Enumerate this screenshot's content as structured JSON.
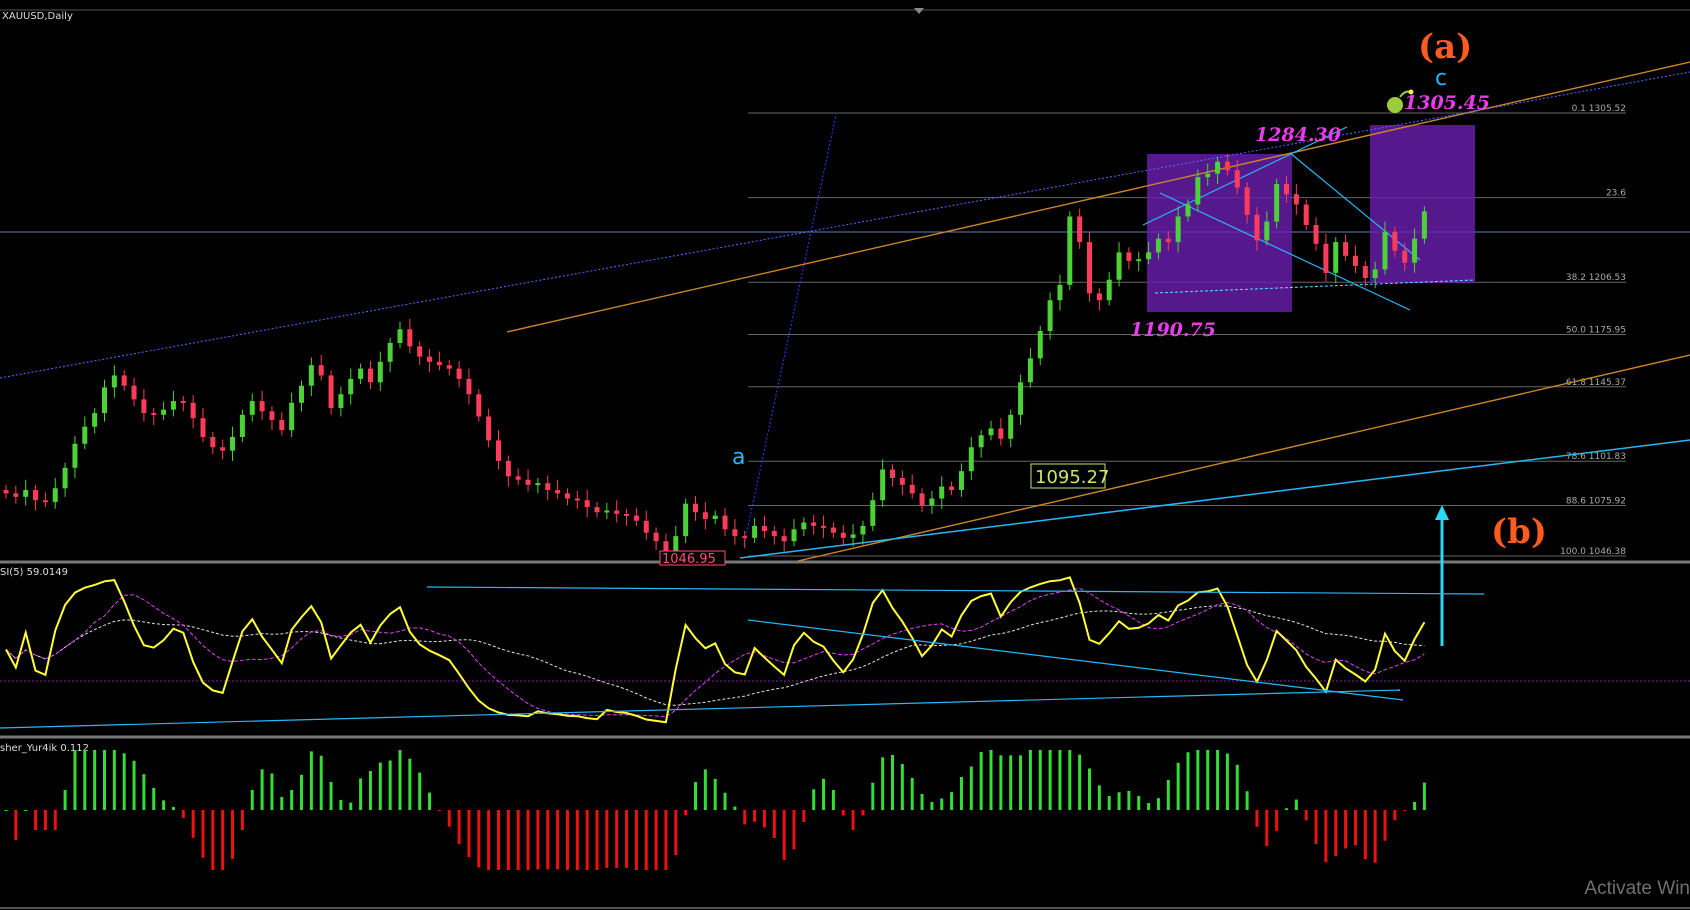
{
  "symbol_label": "XAUUSD,Daily",
  "rsi_label": "SI(5) 59.0149",
  "fisher_label": "sher_Yur4ik 0.112",
  "watermark": "Activate Win",
  "wave_labels": {
    "a_small": "a",
    "c_small": "c",
    "a_big": "(a)",
    "b_big": "(b)"
  },
  "price_labels": {
    "high1": "1284.30",
    "high2": "1305.45",
    "low1": "1190.75",
    "box1": "1095.27",
    "low0": "1046.95"
  },
  "fib_levels": [
    {
      "label": "0.1 1305.52",
      "price": 1305.52
    },
    {
      "label": "23.6",
      "price": 1256.0
    },
    {
      "label": "38.2 1206.53",
      "price": 1206.53
    },
    {
      "label": "50.0 1175.95",
      "price": 1175.95
    },
    {
      "label": "61.8 1145.37",
      "price": 1145.37
    },
    {
      "label": "78.6 1101.83",
      "price": 1101.83
    },
    {
      "label": "88.6 1075.92",
      "price": 1075.92
    },
    {
      "label": "100.0 1046.38",
      "price": 1046.38
    }
  ],
  "colors": {
    "bull": "#4cd137",
    "bear": "#ff3b5c",
    "rsi": "#ffff33",
    "rsi_ma": "#e040fb",
    "rsi_ma2": "#e0e0e0",
    "trend_blue": "#29b6f6",
    "trend_orange": "#c8862a",
    "box": "#6a1fb0",
    "fisher_up": "#33dd33",
    "fisher_down": "#ee1111"
  },
  "chart_data": {
    "type": "candlestick",
    "title": "XAUUSD,Daily",
    "ylim": [
      1040,
      1325
    ],
    "closes": [
      1083,
      1081,
      1085,
      1079,
      1078,
      1086,
      1098,
      1112,
      1122,
      1130,
      1145,
      1152,
      1146,
      1138,
      1130,
      1129,
      1132,
      1137,
      1136,
      1127,
      1116,
      1110,
      1108,
      1116,
      1129,
      1137,
      1131,
      1126,
      1120,
      1136,
      1146,
      1158,
      1152,
      1133,
      1141,
      1150,
      1156,
      1148,
      1160,
      1171,
      1179,
      1169,
      1163,
      1160,
      1158,
      1156,
      1150,
      1141,
      1128,
      1114,
      1102,
      1093,
      1091,
      1088,
      1089,
      1085,
      1083,
      1080,
      1079,
      1075,
      1072,
      1073,
      1071,
      1070,
      1067,
      1060,
      1055,
      1048,
      1058,
      1077,
      1072,
      1068,
      1070,
      1062,
      1058,
      1057,
      1064,
      1061,
      1058,
      1055,
      1062,
      1066,
      1064,
      1063,
      1060,
      1057,
      1059,
      1064,
      1079,
      1097,
      1092,
      1088,
      1083,
      1076,
      1080,
      1087,
      1085,
      1096,
      1110,
      1117,
      1121,
      1115,
      1129,
      1148,
      1162,
      1178,
      1196,
      1205,
      1245,
      1230,
      1200,
      1196,
      1208,
      1224,
      1219,
      1220,
      1224,
      1232,
      1230,
      1245,
      1252,
      1268,
      1270,
      1277,
      1272,
      1262,
      1246,
      1231,
      1242,
      1264,
      1258,
      1252,
      1240,
      1229,
      1212,
      1230,
      1222,
      1216,
      1209,
      1214,
      1236,
      1225,
      1218,
      1232,
      1248
    ]
  },
  "rsi_data": {
    "type": "line",
    "ylim": [
      0,
      100
    ],
    "levels": [
      50
    ]
  },
  "fisher_data": {
    "type": "histogram",
    "ylim": [
      -1.5,
      1.5
    ]
  }
}
